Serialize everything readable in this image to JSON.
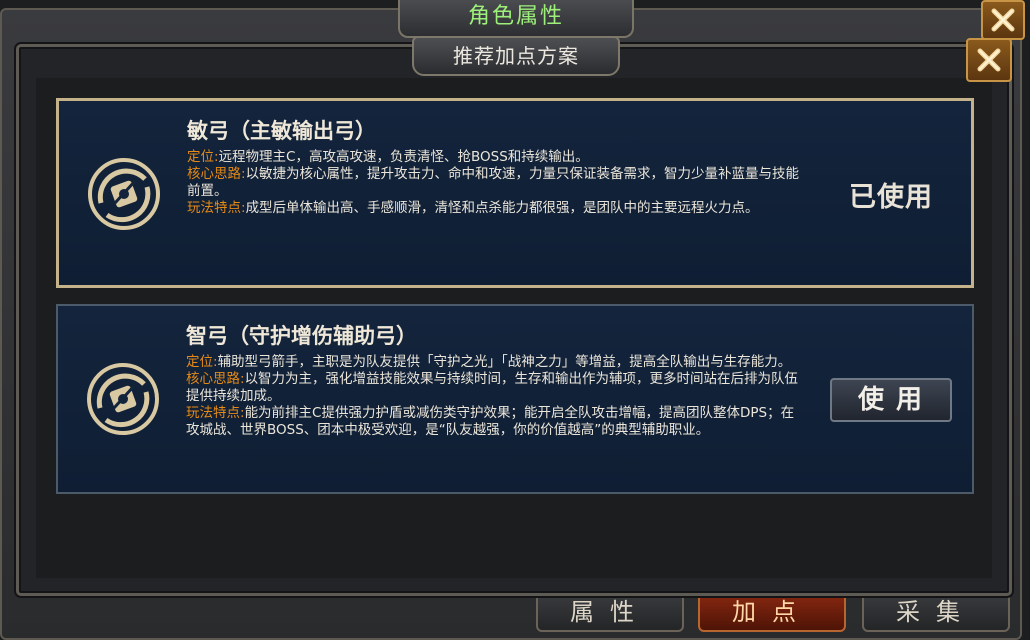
{
  "outer_window": {
    "title": "角色属性",
    "bottom_tabs": [
      {
        "label": "属性",
        "active": false
      },
      {
        "label": "加点",
        "active": true
      },
      {
        "label": "采集",
        "active": false
      }
    ]
  },
  "dialog": {
    "title": "推荐加点方案"
  },
  "plans": [
    {
      "name": "敏弓（主敏输出弓）",
      "positioning_label": "定位:",
      "positioning": "远程物理主C，高攻高攻速，负责清怪、抢BOSS和持续输出。",
      "core_label": "核心思路:",
      "core": "以敏捷为核心属性，提升攻击力、命中和攻速，力量只保证装备需求，智力少量补蓝量与技能前置。",
      "traits_label": "玩法特点:",
      "traits": "成型后单体输出高、手感顺滑，清怪和点杀能力都很强，是团队中的主要远程火力点。",
      "status": "已使用"
    },
    {
      "name": "智弓（守护增伤辅助弓）",
      "positioning_label": "定位:",
      "positioning": "辅助型弓箭手，主职是为队友提供「守护之光」「战神之力」等增益，提高全队输出与生存能力。",
      "core_label": "核心思路:",
      "core": "以智力为主，强化增益技能效果与持续时间，生存和输出作为辅项，更多时间站在后排为队伍提供持续加成。",
      "traits_label": "玩法特点:",
      "traits": "能为前排主C提供强力护盾或减伤类守护效果；能开启全队攻击增幅，提高团队整体DPS；在攻城战、世界BOSS、团本中极受欢迎，是“队友越强，你的价值越高”的典型辅助职业。",
      "button": "使用"
    }
  ],
  "colors": {
    "accent_label": "#e58a16",
    "outer_title": "#9df07a",
    "card_bg": "#13243c",
    "selected_border": "#c4b28a"
  },
  "icons": {
    "plan_emblem": "bow-emblem-icon",
    "close": "close-icon"
  }
}
